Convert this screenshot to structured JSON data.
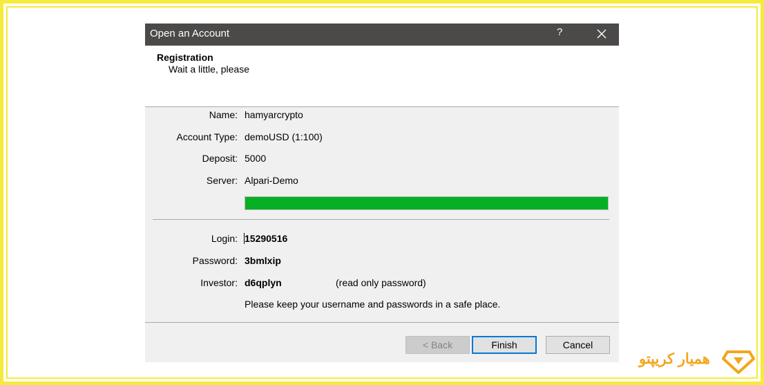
{
  "dialog": {
    "title": "Open an Account",
    "help_label": "?",
    "header": {
      "title": "Registration",
      "subtitle": "Wait a little, please"
    },
    "fields": [
      {
        "label": "Name:",
        "value": "hamyarcrypto"
      },
      {
        "label": "Account Type:",
        "value": "demoUSD (1:100)"
      },
      {
        "label": "Deposit:",
        "value": "5000"
      },
      {
        "label": "Server:",
        "value": "Alpari-Demo"
      }
    ],
    "progress": {
      "percent": 100,
      "color": "#06b025"
    },
    "credentials": {
      "login_label": "Login:",
      "login": "15290516",
      "password_label": "Password:",
      "password": "3bmlxip",
      "investor_label": "Investor:",
      "investor": "d6qplyn",
      "investor_note": "(read only password)",
      "notice": "Please keep your username and passwords in a safe place."
    },
    "buttons": {
      "back": "< Back",
      "finish": "Finish",
      "cancel": "Cancel"
    }
  },
  "brand": {
    "text": "همیار کریپتو",
    "color": "#f3a51c"
  },
  "colors": {
    "titlebar": "#4c4a48",
    "frame": "#f6ea3a"
  }
}
